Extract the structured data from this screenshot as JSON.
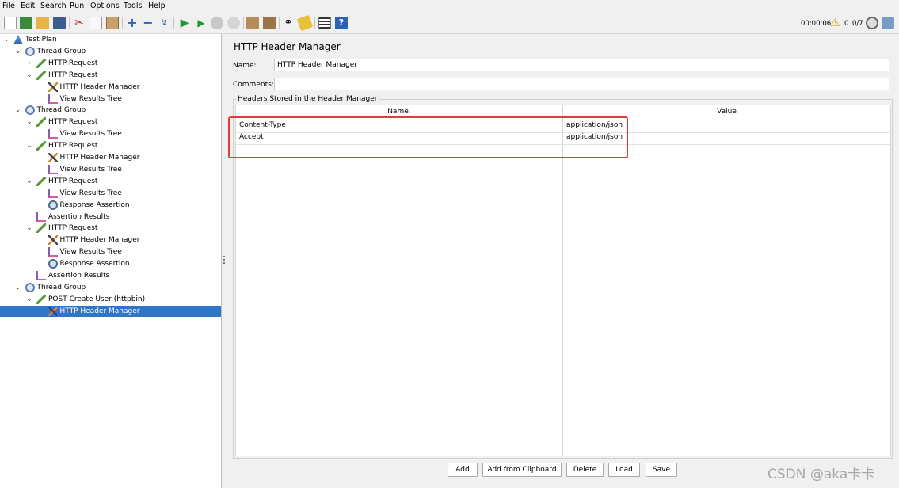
{
  "menu": [
    "File",
    "Edit",
    "Search",
    "Run",
    "Options",
    "Tools",
    "Help"
  ],
  "status": {
    "time": "00:00:06",
    "warnings": "0",
    "threads": "0/7"
  },
  "tree": [
    {
      "label": "Test Plan",
      "icon": "test-plan-icon",
      "expanded": true
    },
    {
      "label": "Thread Group",
      "icon": "thread-group-icon",
      "expanded": true
    },
    {
      "label": "HTTP Request",
      "icon": "sampler-icon",
      "expanded": false
    },
    {
      "label": "HTTP Request",
      "icon": "sampler-icon",
      "expanded": true
    },
    {
      "label": "HTTP Header Manager",
      "icon": "header-manager-icon"
    },
    {
      "label": "View Results Tree",
      "icon": "listener-icon"
    },
    {
      "label": "Thread Group",
      "icon": "thread-group-icon",
      "expanded": true
    },
    {
      "label": "HTTP Request",
      "icon": "sampler-icon",
      "expanded": true
    },
    {
      "label": "View Results Tree",
      "icon": "listener-icon"
    },
    {
      "label": "HTTP Request",
      "icon": "sampler-icon",
      "expanded": true
    },
    {
      "label": "HTTP Header Manager",
      "icon": "header-manager-icon"
    },
    {
      "label": "View Results Tree",
      "icon": "listener-icon"
    },
    {
      "label": "HTTP Request",
      "icon": "sampler-icon",
      "expanded": true
    },
    {
      "label": "View Results Tree",
      "icon": "listener-icon"
    },
    {
      "label": "Response Assertion",
      "icon": "assertion-icon"
    },
    {
      "label": "Assertion Results",
      "icon": "listener-icon"
    },
    {
      "label": "HTTP Request",
      "icon": "sampler-icon",
      "expanded": true
    },
    {
      "label": "HTTP Header Manager",
      "icon": "header-manager-icon"
    },
    {
      "label": "View Results Tree",
      "icon": "listener-icon"
    },
    {
      "label": "Response Assertion",
      "icon": "assertion-icon"
    },
    {
      "label": "Assertion Results",
      "icon": "listener-icon"
    },
    {
      "label": "Thread Group",
      "icon": "thread-group-icon",
      "expanded": true
    },
    {
      "label": "POST Create User (httpbin)",
      "icon": "sampler-icon",
      "expanded": true
    },
    {
      "label": "HTTP Header Manager",
      "icon": "header-manager-icon",
      "selected": true
    }
  ],
  "panel": {
    "title": "HTTP Header Manager",
    "name_label": "Name:",
    "name_value": "HTTP Header Manager",
    "comments_label": "Comments:",
    "comments_value": "",
    "group_label": "Headers Stored in the Header Manager",
    "col_name": "Name:",
    "col_value": "Value",
    "rows": [
      {
        "name": "Content-Type",
        "value": "application/json"
      },
      {
        "name": "Accept",
        "value": "application/json"
      }
    ],
    "buttons": {
      "add": "Add",
      "add_clipboard": "Add from Clipboard",
      "delete": "Delete",
      "load": "Load",
      "save": "Save"
    }
  },
  "watermark": "CSDN @aka卡卡",
  "colors": {
    "selection": "#2f76c6",
    "highlight": "#e53a3a"
  }
}
